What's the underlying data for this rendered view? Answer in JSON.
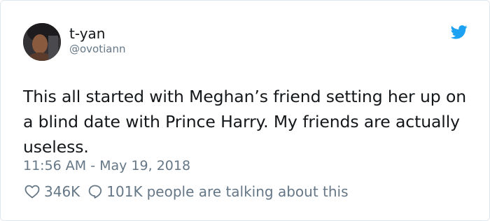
{
  "user": {
    "display_name": "t-yan",
    "handle": "@ovotiann"
  },
  "tweet": {
    "text": "This all started with Meghan’s friend setting her up on a blind date with Prince Harry. My friends are actually useless.",
    "timestamp": "11:56 AM - May 19, 2018"
  },
  "engagement": {
    "likes": "346K",
    "replies": "101K",
    "talking_text": "people are talking about this"
  },
  "colors": {
    "twitter_blue": "#1da1f2",
    "text_primary": "#14171a",
    "text_secondary": "#657786"
  },
  "icons": {
    "brand": "twitter-bird-icon",
    "like": "heart-icon",
    "reply": "speech-bubble-icon"
  }
}
